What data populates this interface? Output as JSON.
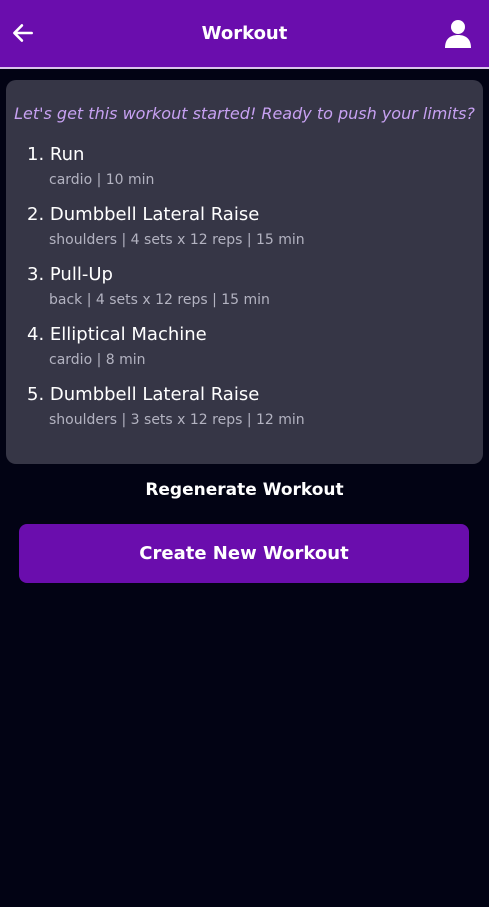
{
  "header": {
    "title": "Workout",
    "back_icon": "arrow-left-icon",
    "profile_icon": "user-icon"
  },
  "workout": {
    "motivation": "Let's get this workout started! Ready to push your limits?",
    "exercises": [
      {
        "name": "1. Run",
        "details": "cardio | 10 min"
      },
      {
        "name": "2. Dumbbell Lateral Raise",
        "details": "shoulders | 4 sets x 12 reps | 15 min"
      },
      {
        "name": "3. Pull-Up",
        "details": "back | 4 sets x 12 reps | 15 min"
      },
      {
        "name": "4. Elliptical Machine",
        "details": "cardio | 8 min"
      },
      {
        "name": "5. Dumbbell Lateral Raise",
        "details": "shoulders | 3 sets x 12 reps | 12 min"
      }
    ]
  },
  "actions": {
    "regenerate_label": "Regenerate Workout",
    "create_label": "Create New Workout"
  },
  "colors": {
    "accent": "#6a0dad",
    "background": "#020314",
    "card": "#363646",
    "motivation_text": "#c7a1f2"
  }
}
